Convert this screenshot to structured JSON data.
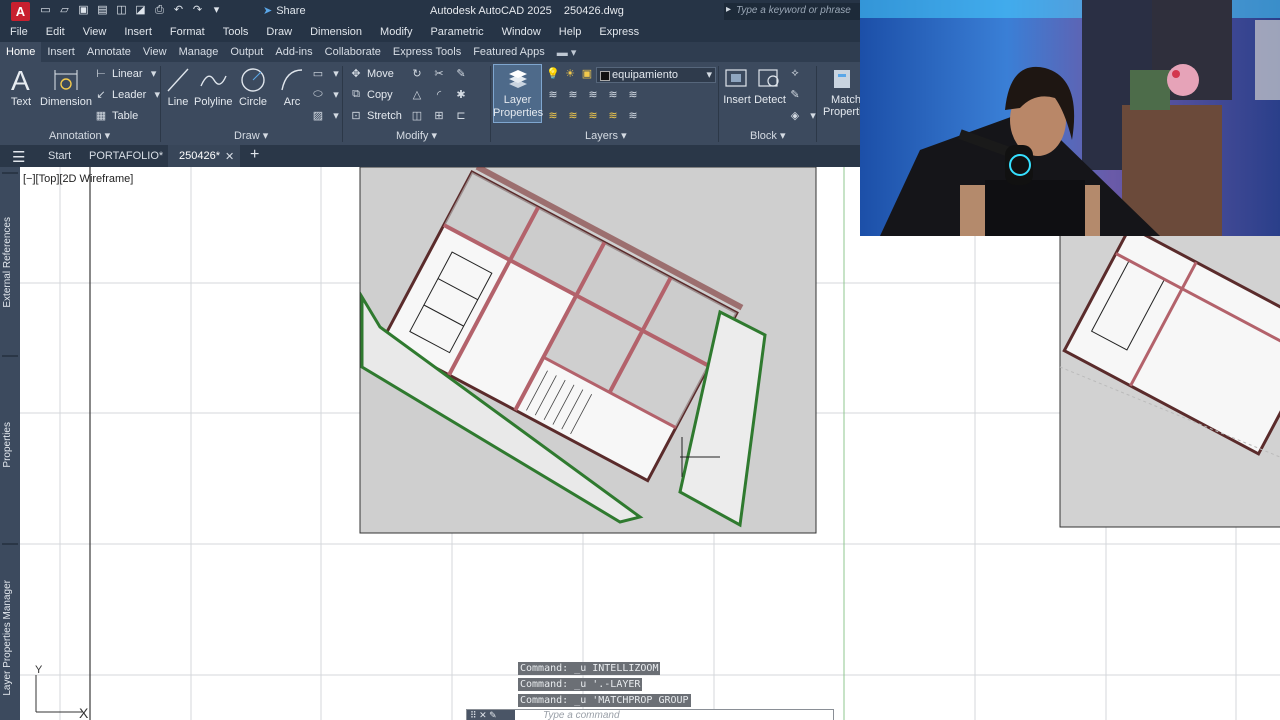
{
  "window": {
    "title": "Autodesk AutoCAD 2025    250426.dwg",
    "app_logo": "A",
    "share_label": "Share",
    "search_placeholder": "Type a keyword or phrase"
  },
  "menu": [
    "File",
    "Edit",
    "View",
    "Insert",
    "Format",
    "Tools",
    "Draw",
    "Dimension",
    "Modify",
    "Parametric",
    "Window",
    "Help",
    "Express"
  ],
  "ribbon_tabs": [
    "Home",
    "Insert",
    "Annotate",
    "View",
    "Manage",
    "Output",
    "Add-ins",
    "Collaborate",
    "Express Tools",
    "Featured Apps"
  ],
  "ribbon": {
    "annotation": {
      "title": "Annotation",
      "text": "Text",
      "dimension": "Dimension",
      "linear": "Linear",
      "leader": "Leader",
      "table": "Table"
    },
    "draw": {
      "title": "Draw",
      "line": "Line",
      "polyline": "Polyline",
      "circle": "Circle",
      "arc": "Arc"
    },
    "modify": {
      "title": "Modify",
      "move": "Move",
      "copy": "Copy",
      "stretch": "Stretch"
    },
    "layers": {
      "title": "Layers",
      "layer_properties_1": "Layer",
      "layer_properties_2": "Properties",
      "current_layer": "equipamiento"
    },
    "block": {
      "title": "Block",
      "insert": "Insert",
      "detect": "Detect",
      "match_1": "Match",
      "match_2": "Properti"
    }
  },
  "doc_tabs": {
    "start": "Start",
    "portfolio": "PORTAFOLIO*",
    "active": "250426*"
  },
  "side_palettes": [
    "External References",
    "Properties",
    "Layer Properties Manager"
  ],
  "viewport_label": "[−][Top][2D Wireframe]",
  "commands": [
    "Command: _u INTELLIZOOM",
    "Command: _u '.-LAYER",
    "Command: _u 'MATCHPROP GROUP"
  ],
  "command_placeholder": "Type a command",
  "ucs": {
    "x": "X",
    "y": "Y"
  },
  "colors": {
    "title_bar": "#263446",
    "ribbon": "#3c4a5e",
    "app_logo": "#c8202f",
    "accent": "#5aa7e8"
  }
}
